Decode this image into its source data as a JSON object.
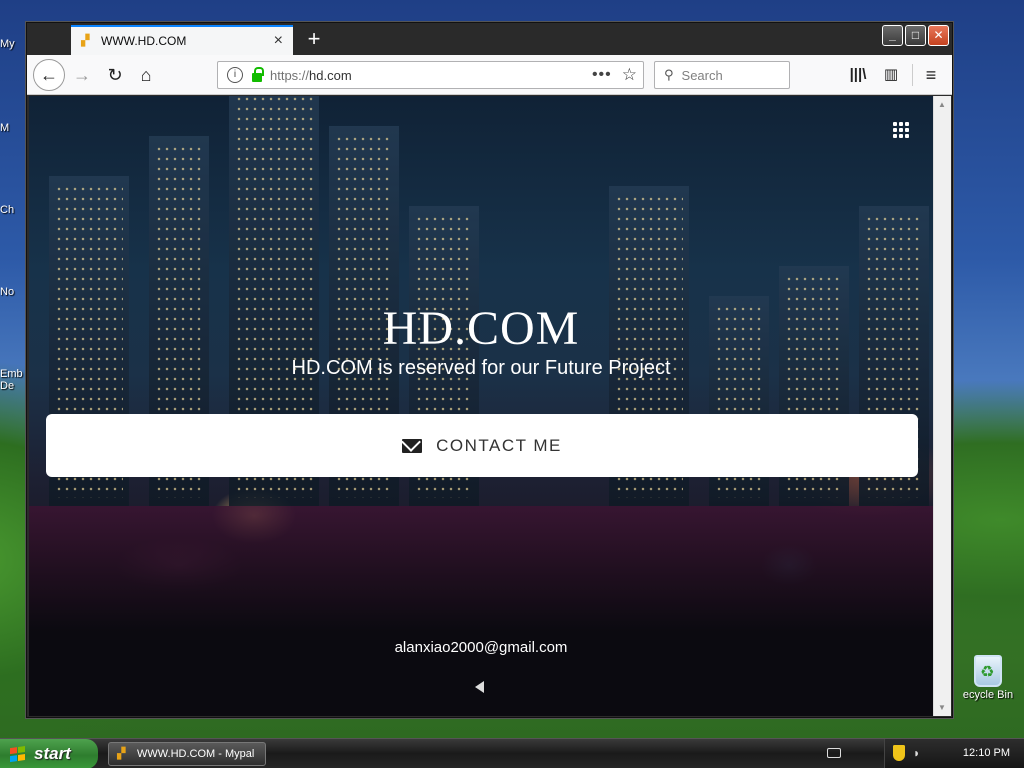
{
  "desktop": {
    "left_labels": [
      "My",
      "M",
      "Ch",
      "No",
      "Emb",
      "De"
    ],
    "recycle_bin_label": "ecycle Bin"
  },
  "browser": {
    "tab": {
      "title": "WWW.HD.COM",
      "close": "×"
    },
    "new_tab": "+",
    "window_buttons": {
      "minimize": "_",
      "maximize": "□",
      "close": "✕"
    },
    "nav": {
      "url_scheme": "https://",
      "url_host": "hd.com",
      "page_actions": "•••",
      "search_placeholder": "Search"
    }
  },
  "page": {
    "title": "HD.COM",
    "subtitle": "HD.COM is reserved for our Future Project",
    "contact_label": "CONTACT ME",
    "email": "alanxiao2000@gmail.com"
  },
  "taskbar": {
    "start_label": "start",
    "task_item": "WWW.HD.COM - Mypal",
    "clock": "12:10 PM"
  },
  "colors": {
    "tab_accent": "#0a84ff",
    "lock_green": "#12bc00",
    "start_green": "#3a9a3a"
  }
}
